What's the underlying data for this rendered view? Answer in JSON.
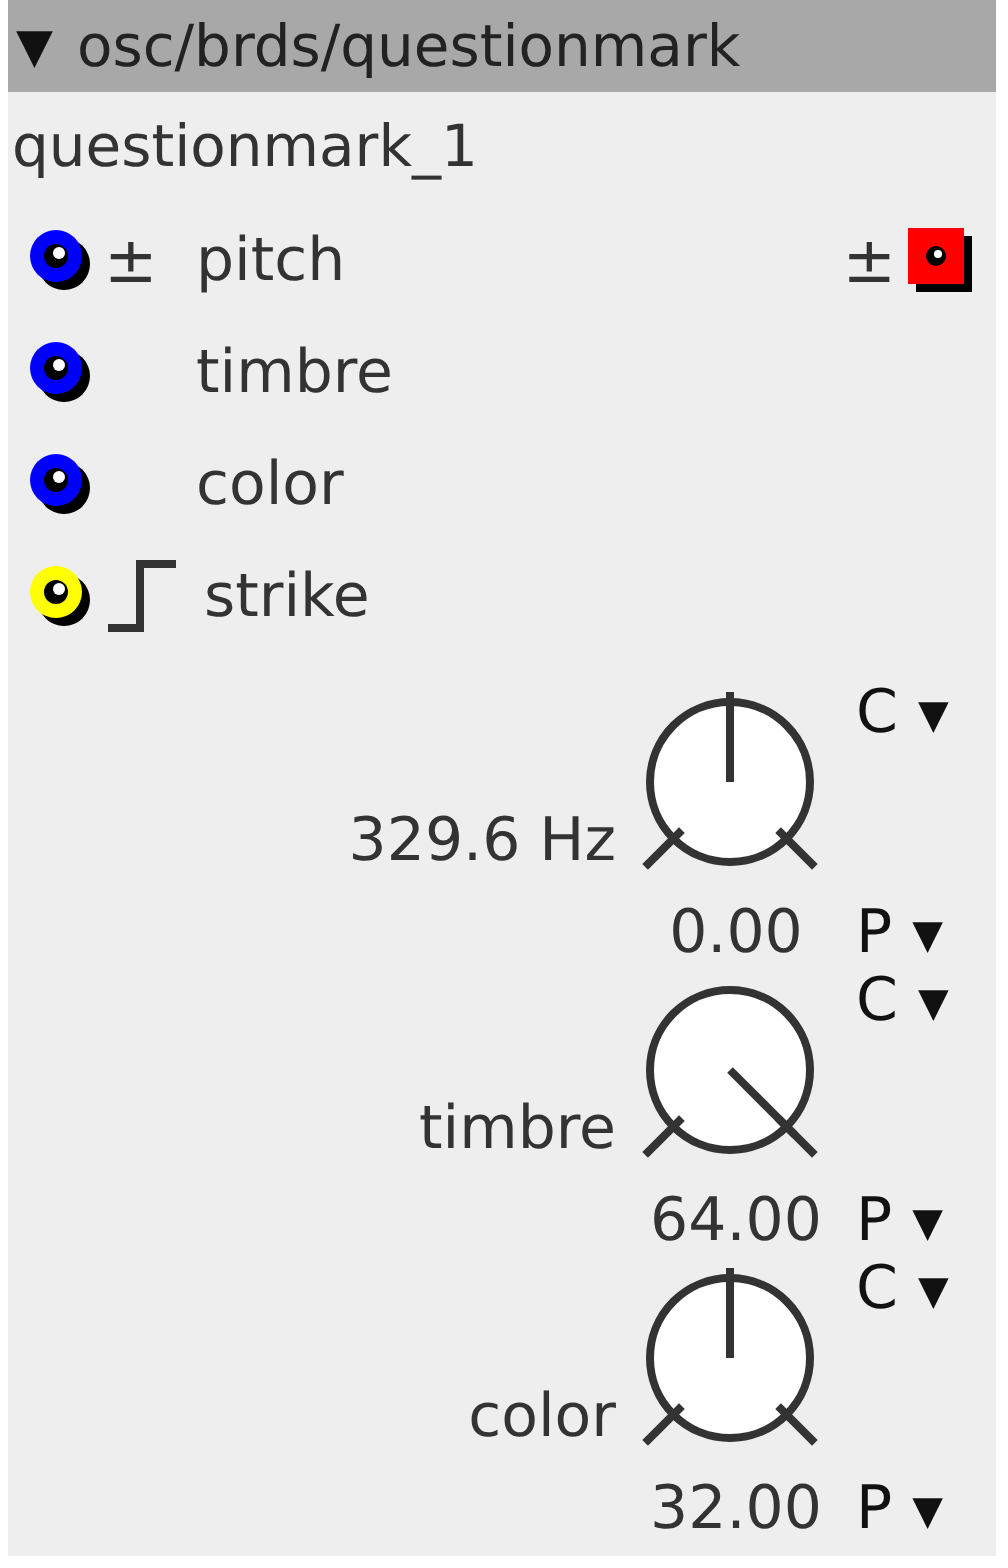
{
  "title_bar": {
    "toggle": "▼",
    "title": "osc/brds/questionmark"
  },
  "instance": "questionmark_1",
  "inlets": [
    {
      "name": "pitch",
      "kind": "bipolar",
      "symbol": "±",
      "color": "#0000ff"
    },
    {
      "name": "timbre",
      "kind": "plain",
      "color": "#0000ff"
    },
    {
      "name": "color",
      "kind": "plain",
      "color": "#0000ff"
    },
    {
      "name": "strike",
      "kind": "trigger",
      "color": "#ffff00"
    }
  ],
  "outlet": {
    "symbol": "±",
    "color": "#ff0000"
  },
  "knobs": [
    {
      "label": "329.6 Hz",
      "value": "0.00",
      "c": "C",
      "p": "P",
      "arrow": "▼"
    },
    {
      "label": "timbre",
      "value": "64.00",
      "c": "C",
      "p": "P",
      "arrow": "▼"
    },
    {
      "label": "color",
      "value": "32.00",
      "c": "C",
      "p": "P",
      "arrow": "▼"
    }
  ]
}
